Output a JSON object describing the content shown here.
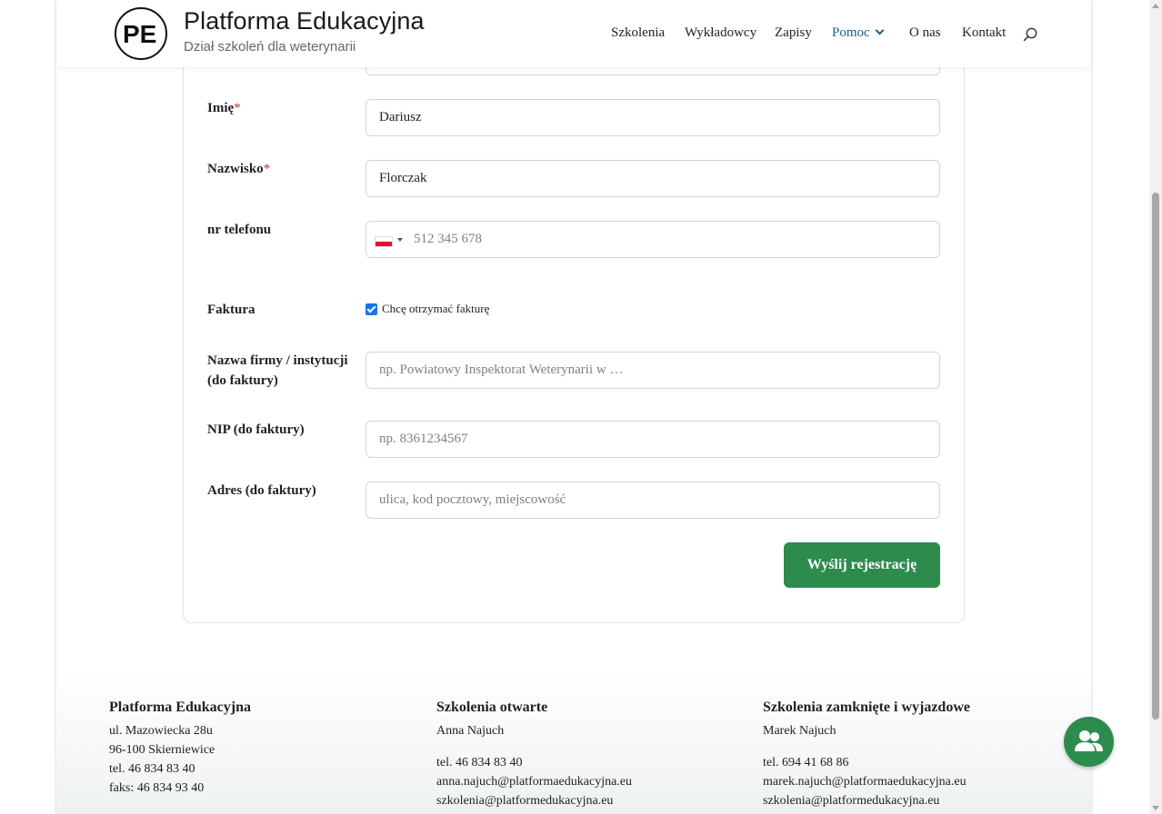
{
  "header": {
    "brand_title": "Platforma Edukacyjna",
    "brand_subtitle": "Dział szkoleń dla weterynarii",
    "logo_text": "PE",
    "nav": [
      {
        "label": "Szkolenia"
      },
      {
        "label": "Wykładowcy"
      },
      {
        "label": "Zapisy"
      },
      {
        "label": "Pomoc",
        "active": true,
        "has_dropdown": true
      },
      {
        "label": "O nas"
      },
      {
        "label": "Kontakt"
      }
    ]
  },
  "form": {
    "first_name": {
      "label": "Imię",
      "required_mark": "*",
      "value": "Dariusz"
    },
    "last_name": {
      "label": "Nazwisko",
      "required_mark": "*",
      "value": "Florczak"
    },
    "phone": {
      "label": "nr telefonu",
      "placeholder": "512 345 678",
      "country_flag": "Poland"
    },
    "invoice": {
      "label": "Faktura",
      "checkbox_label": "Chcę otrzymać fakturę",
      "checked": true
    },
    "company": {
      "label": "Nazwa firmy / instytucji (do faktury)",
      "placeholder": "np. Powiatowy Inspektorat Weterynarii w …"
    },
    "nip": {
      "label": "NIP (do faktury)",
      "placeholder": "np. 8361234567"
    },
    "address": {
      "label": "Adres (do faktury)",
      "placeholder": "ulica, kod pocztowy, miejscowość"
    },
    "submit_label": "Wyślij rejestrację"
  },
  "footer": {
    "col1": {
      "title": "Platforma Edukacyjna",
      "line1": "ul. Mazowiecka 28u",
      "line2": "96-100 Skierniewice",
      "line3": "tel. 46 834 83 40",
      "line4": "faks: 46 834 93 40"
    },
    "col2": {
      "title": "Szkolenia otwarte",
      "person": "Anna Najuch",
      "tel": "tel. 46 834 83 40",
      "email1": "anna.najuch@platformaedukacyjna.eu",
      "email2": "szkolenia@platformedukacyjna.eu"
    },
    "col3": {
      "title": "Szkolenia zamknięte i wyjazdowe",
      "person": "Marek Najuch",
      "tel": "tel. 694 41 68 86",
      "email1": "marek.najuch@platformaedukacyjna.eu",
      "email2": "szkolenia@platformedukacyjna.eu"
    }
  },
  "colors": {
    "accent_green": "#2e8b4e",
    "nav_active": "#1f5d8a",
    "required": "#c0392b"
  },
  "icons": {
    "search": "search-icon",
    "fab": "users-icon"
  }
}
